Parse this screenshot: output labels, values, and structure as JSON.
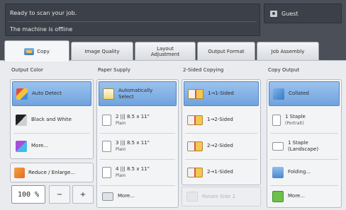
{
  "status": {
    "line1": "Ready to scan your job.",
    "line2": "The machine is offline",
    "user": "Guest"
  },
  "tabs": [
    {
      "label": "Copy"
    },
    {
      "label": "Image Quality"
    },
    {
      "label": "Layout Adjustment"
    },
    {
      "label": "Output Format"
    },
    {
      "label": "Job Assembly"
    }
  ],
  "output_color": {
    "header": "Output Color",
    "options": [
      "Auto Detect",
      "Black and White",
      "More..."
    ],
    "selected": "Auto Detect"
  },
  "reduce_enlarge": {
    "label": "Reduce / Enlarge...",
    "percent": "100 %",
    "minus": "−",
    "plus": "+"
  },
  "paper_supply": {
    "header": "Paper Supply",
    "options": [
      {
        "line1": "Automatically",
        "line2": "Select"
      },
      {
        "line1": "2  ||| 8.5 x 11\"",
        "line2": "Plain"
      },
      {
        "line1": "3  ||| 8.5 x 11\"",
        "line2": "Plain"
      },
      {
        "line1": "4  ||| 8.5 x 11\"",
        "line2": "Plain"
      },
      {
        "line1": "More...",
        "line2": ""
      }
    ],
    "selected": "Automatically Select"
  },
  "two_sided": {
    "header": "2-Sided Copying",
    "options": [
      "1→1-Sided",
      "1→2-Sided",
      "2→2-Sided",
      "2→1-Sided"
    ],
    "selected": "1→1-Sided",
    "disabled_option": "Rotate Side 2"
  },
  "copy_output": {
    "header": "Copy Output",
    "options": [
      {
        "line1": "Collated",
        "line2": ""
      },
      {
        "line1": "1 Staple",
        "line2": "(Portrait)"
      },
      {
        "line1": "1 Staple",
        "line2": "(Landscape)"
      },
      {
        "line1": "Folding...",
        "line2": ""
      },
      {
        "line1": "More...",
        "line2": ""
      }
    ],
    "selected": "Collated"
  },
  "colors": {
    "accent": "#6fa3de",
    "header_bg": "#4a4f58",
    "panel_bg": "#e9ebee"
  }
}
